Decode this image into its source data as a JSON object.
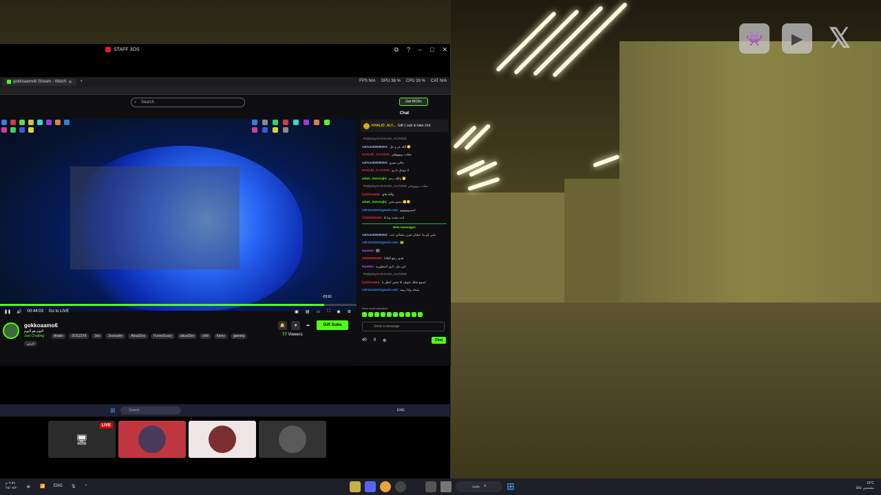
{
  "window": {
    "title": "STAFF 3OS"
  },
  "browser": {
    "tab_label": "gokkoaamo6 Stream - Watch",
    "stats": [
      "FPS N/A",
      "GPU 38 %",
      "CPU 19 %",
      "CAT N/A"
    ],
    "search_placeholder": "Search",
    "get_kicks_label": "Get KICKs",
    "chat_btn_label": "Chat"
  },
  "video": {
    "time_elapsed": "00:44:03",
    "go_live_label": "Go to LIVE",
    "time_remaining": "-03:61",
    "progress": 0.91
  },
  "channel": {
    "name": "gokkoaamo6",
    "title": "اليوم هو اليوم",
    "category": "Just Chatting",
    "tags": [
      "Arabic",
      "3OS2378",
      "3os",
      "3osnader",
      "Abual3os",
      "FunnyScary",
      "abual3os",
      "chill",
      "funny",
      "gaming"
    ],
    "tag_second_row": "عربي",
    "viewers_count": "77",
    "viewers_label": "Viewers",
    "gift_label": "Gift Subs"
  },
  "chat": {
    "header": "Chat",
    "pinned_name": "KHALID_ALY...",
    "pinned_text": "Gift 1 sub to take 2nd",
    "new_messages_label": "New messages",
    "slow_mode": "Slow mode activated",
    "input_placeholder": "Send a message",
    "points": "40",
    "other_count": "0",
    "send_label": "Chat",
    "messages": [
      {
        "user": "",
        "text": "Replying to KHALID_ALYA033:",
        "color": "#999999"
      },
      {
        "user": "salman82838363:",
        "text": "الله عز و جل 😁",
        "color": "#b0b0ff"
      },
      {
        "user": "KHALID_ALYA033:",
        "text": "مقلب رووووقي",
        "color": "#e0303f"
      },
      {
        "user": "salman82838363:",
        "text": "مافي سيرو",
        "color": "#b0b0ff"
      },
      {
        "user": "KHALID_ALYA033:",
        "text": "لا موحل داري",
        "color": "#e0303f"
      },
      {
        "user": "adam_2wourghi:",
        "text": "والله رحم 😁",
        "color": "#53fc18"
      },
      {
        "user": "",
        "text": "Replying to KHALID_ALYA033: مقلب رووووقي",
        "color": "#999999"
      },
      {
        "user": "lyakhoaqeq:",
        "text": "والله هاي",
        "color": "#e0303f"
      },
      {
        "user": "adam_2wourghi:",
        "text": "مسو بنحن 😁😁",
        "color": "#53fc18"
      },
      {
        "user": "z3lr1111110@gmail.com:",
        "text": "اسيروووووو",
        "color": "#3f8cff"
      },
      {
        "user": "23559384949:",
        "text": "انت تبحث وداعا",
        "color": "#e0303f"
      }
    ],
    "messages_new": [
      {
        "user": "salman82838363:",
        "text": "دلني كو بدا عشان تقرن بتشالي خب",
        "color": "#b0b0ff"
      },
      {
        "user": "z3lr1111110@gmail.com:",
        "text": "🐸",
        "color": "#3f8cff"
      },
      {
        "user": "lepwlez:",
        "text": "🖼",
        "color": "#c050ff"
      },
      {
        "user": "23559384949:",
        "text": "قدي رجع البلادا",
        "color": "#e0303f"
      },
      {
        "user": "lepwlez:",
        "text": "اني بدل داري اسطوريه",
        "color": "#c050ff"
      },
      {
        "user": "",
        "text": "Replying to KHALID_ALYA033:",
        "color": "#999999"
      },
      {
        "user": "lyakhoaqeq:",
        "text": "اسمع شلك شوف انا نفس انظل يا",
        "color": "#e0303f"
      },
      {
        "user": "z3lr1111110@gmail.com:",
        "text": "منحك ولنا ربيبه",
        "color": "#3f8cff"
      }
    ]
  },
  "inner_taskbar": {
    "search_placeholder": "Search",
    "lang": "ENG"
  },
  "taskbar": {
    "search_label": "بحث",
    "lang": "ENG",
    "weather": "19°C",
    "weather_desc": "مشمس غالبًا",
    "time": "٩:٥٩ م",
    "date": "٢٥/٠٨/٢٠"
  },
  "colors": {
    "kick_green": "#53fc18",
    "live_red": "#ee0000"
  }
}
